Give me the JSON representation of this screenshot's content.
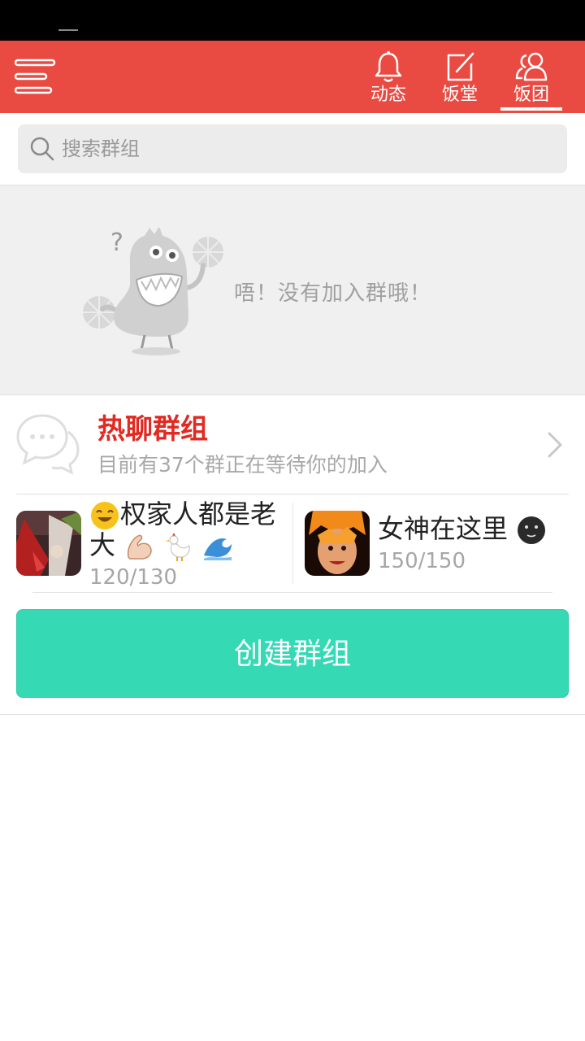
{
  "topbar": {
    "bg_color": "#e94b42",
    "tabs": [
      {
        "label": "动态",
        "icon": "bell-icon"
      },
      {
        "label": "饭堂",
        "icon": "edit-icon"
      },
      {
        "label": "饭团",
        "icon": "users-icon",
        "active": true
      }
    ]
  },
  "search": {
    "placeholder": "搜索群组"
  },
  "empty_state": {
    "message": "唔！没有加入群哦！"
  },
  "hot_groups": {
    "title": "热聊群组",
    "subtitle": "目前有37个群正在等待你的加入",
    "title_color": "#e12a22"
  },
  "groups": [
    {
      "name_line1": "权家人都是老",
      "name_line2": "大",
      "count": "120/130"
    },
    {
      "name": "女神在这里",
      "count": "150/150"
    }
  ],
  "create_button": {
    "label": "创建群组",
    "color": "#35dab5"
  }
}
